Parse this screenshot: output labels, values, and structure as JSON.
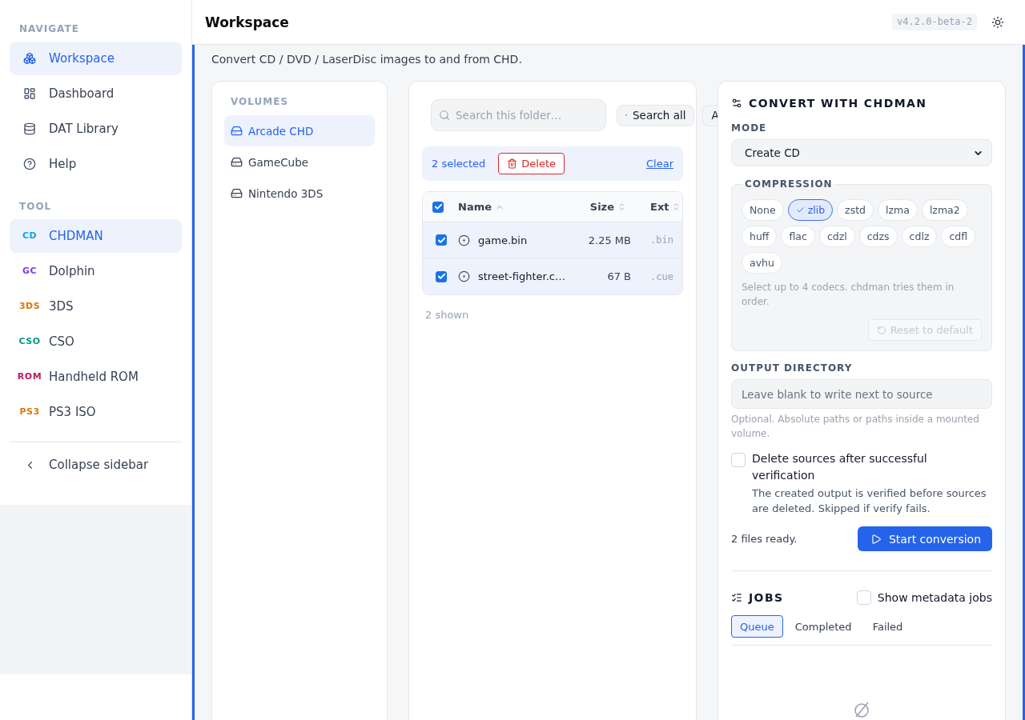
{
  "sidebar": {
    "sections": [
      {
        "heading": "NAVIGATE",
        "items": [
          {
            "kind": "page",
            "label": "Workspace",
            "selected": true
          },
          {
            "kind": "page",
            "label": "Dashboard",
            "selected": false
          },
          {
            "kind": "page",
            "label": "DAT Library",
            "selected": false
          },
          {
            "kind": "page",
            "label": "Help",
            "selected": false
          }
        ]
      },
      {
        "heading": "TOOL",
        "items": [
          {
            "kind": "tool",
            "badge": "CD",
            "color": "#0ea5e9",
            "label": "CHDMAN",
            "selected": true
          },
          {
            "kind": "tool",
            "badge": "GC",
            "color": "#7c3aed",
            "label": "Dolphin",
            "selected": false
          },
          {
            "kind": "tool",
            "badge": "3DS",
            "color": "#d97706",
            "label": "3DS",
            "selected": false
          },
          {
            "kind": "tool",
            "badge": "CSO",
            "color": "#0d9488",
            "label": "CSO",
            "selected": false
          },
          {
            "kind": "tool",
            "badge": "ROM",
            "color": "#be185d",
            "label": "Handheld ROM",
            "selected": false
          },
          {
            "kind": "tool",
            "badge": "PS3",
            "color": "#d97706",
            "label": "PS3 ISO",
            "selected": false
          }
        ]
      }
    ],
    "collapse": "Collapse sidebar"
  },
  "header": {
    "title": "Workspace",
    "version": "v4.2.0-beta-2"
  },
  "subtitle": "Convert CD / DVD / LaserDisc images to and from CHD.",
  "volumes": {
    "heading": "VOLUMES",
    "items": [
      {
        "label": "Arcade CHD",
        "selected": true
      },
      {
        "label": "GameCube",
        "selected": false
      },
      {
        "label": "Nintendo 3DS",
        "selected": false
      }
    ]
  },
  "files": {
    "search": {
      "placeholder": "Search this folder…"
    },
    "scope_buttons": [
      "Search all",
      "A"
    ],
    "selection": {
      "count": "2 selected",
      "delete": "Delete",
      "clear": "Clear"
    },
    "table": {
      "all_checked": true,
      "columns": [
        {
          "label": "Name",
          "sorted": true
        },
        {
          "label": "Size",
          "sorted": false
        },
        {
          "label": "Ext",
          "sorted": false
        }
      ],
      "rows": [
        {
          "name": "game.bin",
          "size": "2.25 MB",
          "ext": ".bin",
          "checked": true
        },
        {
          "name": "street-fighter.c…",
          "size": "67 B",
          "ext": ".cue",
          "checked": true
        }
      ]
    },
    "footer": "2 shown"
  },
  "convert": {
    "title": "CONVERT WITH CHDMAN",
    "mode": {
      "label": "MODE",
      "value": "Create CD"
    },
    "compression": {
      "legend": "COMPRESSION",
      "codecs": [
        {
          "label": "None",
          "selected": false
        },
        {
          "label": "zlib",
          "selected": true
        },
        {
          "label": "zstd",
          "selected": false
        },
        {
          "label": "lzma",
          "selected": false
        },
        {
          "label": "lzma2",
          "selected": false
        },
        {
          "label": "huff",
          "selected": false
        },
        {
          "label": "flac",
          "selected": false
        },
        {
          "label": "cdzl",
          "selected": false
        },
        {
          "label": "cdzs",
          "selected": false
        },
        {
          "label": "cdlz",
          "selected": false
        },
        {
          "label": "cdfl",
          "selected": false
        },
        {
          "label": "avhu",
          "selected": false
        }
      ],
      "hint": "Select up to 4 codecs. chdman tries them in order.",
      "reset": {
        "label": "Reset to default",
        "disabled": true
      }
    },
    "output": {
      "label": "OUTPUT DIRECTORY",
      "placeholder": "Leave blank to write next to source",
      "hint": "Optional. Absolute paths or paths inside a mounted volume."
    },
    "delete_sources": {
      "label": "Delete sources after successful verification",
      "description": "The created output is verified before sources are deleted. Skipped if verify fails.",
      "checked": false
    },
    "status": "2 files ready.",
    "start": "Start conversion"
  },
  "jobs": {
    "title": "JOBS",
    "show_metadata": {
      "label": "Show metadata jobs",
      "checked": false
    },
    "tabs": [
      {
        "label": "Queue",
        "selected": true
      },
      {
        "label": "Completed",
        "selected": false
      },
      {
        "label": "Failed",
        "selected": false
      }
    ]
  }
}
